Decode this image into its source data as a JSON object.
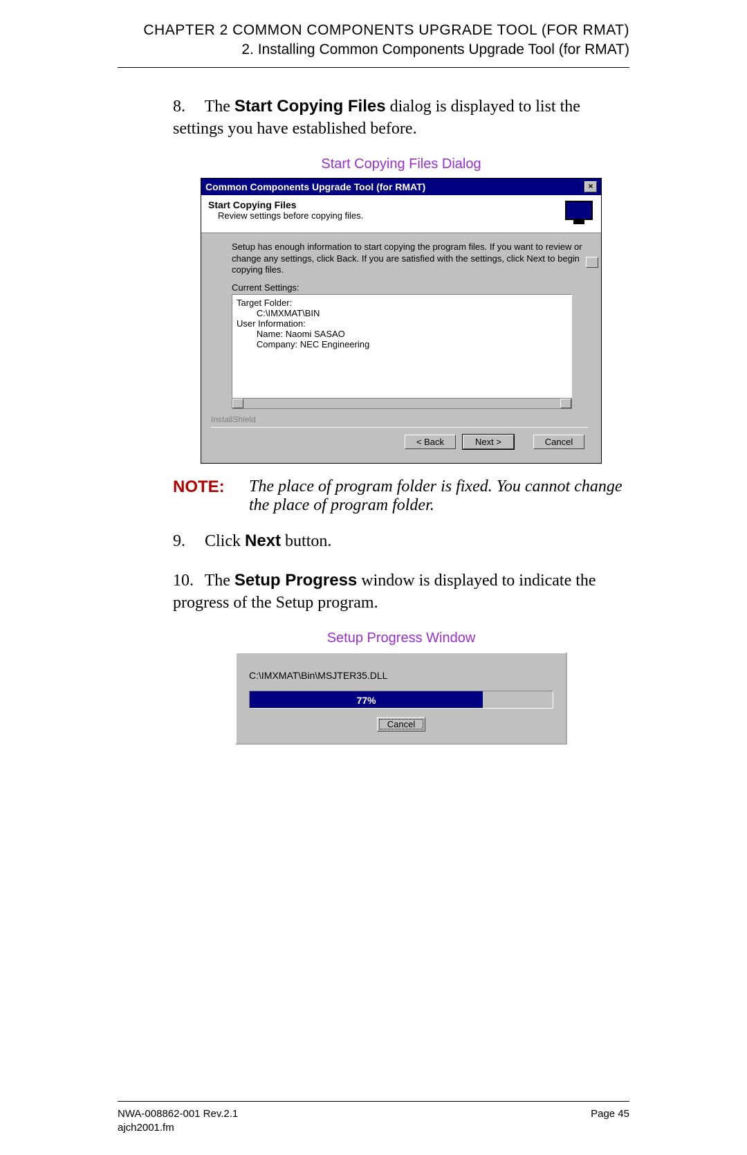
{
  "header": {
    "chapter": "CHAPTER 2 COMMON COMPONENTS UPGRADE TOOL (FOR RMAT)",
    "section": "2. Installing Common Components Upgrade Tool (for RMAT)"
  },
  "steps": {
    "s8_num": "8.",
    "s8_pre": "The ",
    "s8_bold": "Start Copying Files",
    "s8_post": " dialog is displayed to list the settings you have established before.",
    "s9_num": "9.",
    "s9_pre": "Click ",
    "s9_bold": "Next",
    "s9_post": " button.",
    "s10_num": "10.",
    "s10_pre": "The ",
    "s10_bold": "Setup Progress",
    "s10_post": " window is displayed to indicate the progress of the Setup program."
  },
  "captions": {
    "c1": "Start Copying Files Dialog",
    "c2": "Setup Progress Window"
  },
  "note": {
    "label": "NOTE:",
    "text": "The place of program folder is fixed. You cannot change the place of program folder."
  },
  "dlg1": {
    "title": "Common Components Upgrade Tool (for RMAT)",
    "panel_title": "Start Copying Files",
    "panel_sub": "Review settings before copying files.",
    "instructions": "Setup has enough information to start copying the program files. If you want to review or change any settings, click Back. If you are satisfied with the settings, click Next to begin copying files.",
    "current_label": "Current Settings:",
    "settings": {
      "l1": "Target Folder:",
      "l2": "        C:\\IMXMAT\\BIN",
      "l3": "",
      "l4": "User Information:",
      "l5": "        Name: Naomi SASAO",
      "l6": "        Company: NEC Engineering"
    },
    "installshield": "InstallShield",
    "back": "< Back",
    "next": "Next >",
    "cancel": "Cancel",
    "close_x": "×"
  },
  "dlg2": {
    "path": "C:\\IMXMAT\\Bin\\MSJTER35.DLL",
    "percent": "77%",
    "cancel": "Cancel"
  },
  "footer": {
    "left1": "NWA-008862-001 Rev.2.1",
    "left2": "ajch2001.fm",
    "right": "Page 45"
  }
}
